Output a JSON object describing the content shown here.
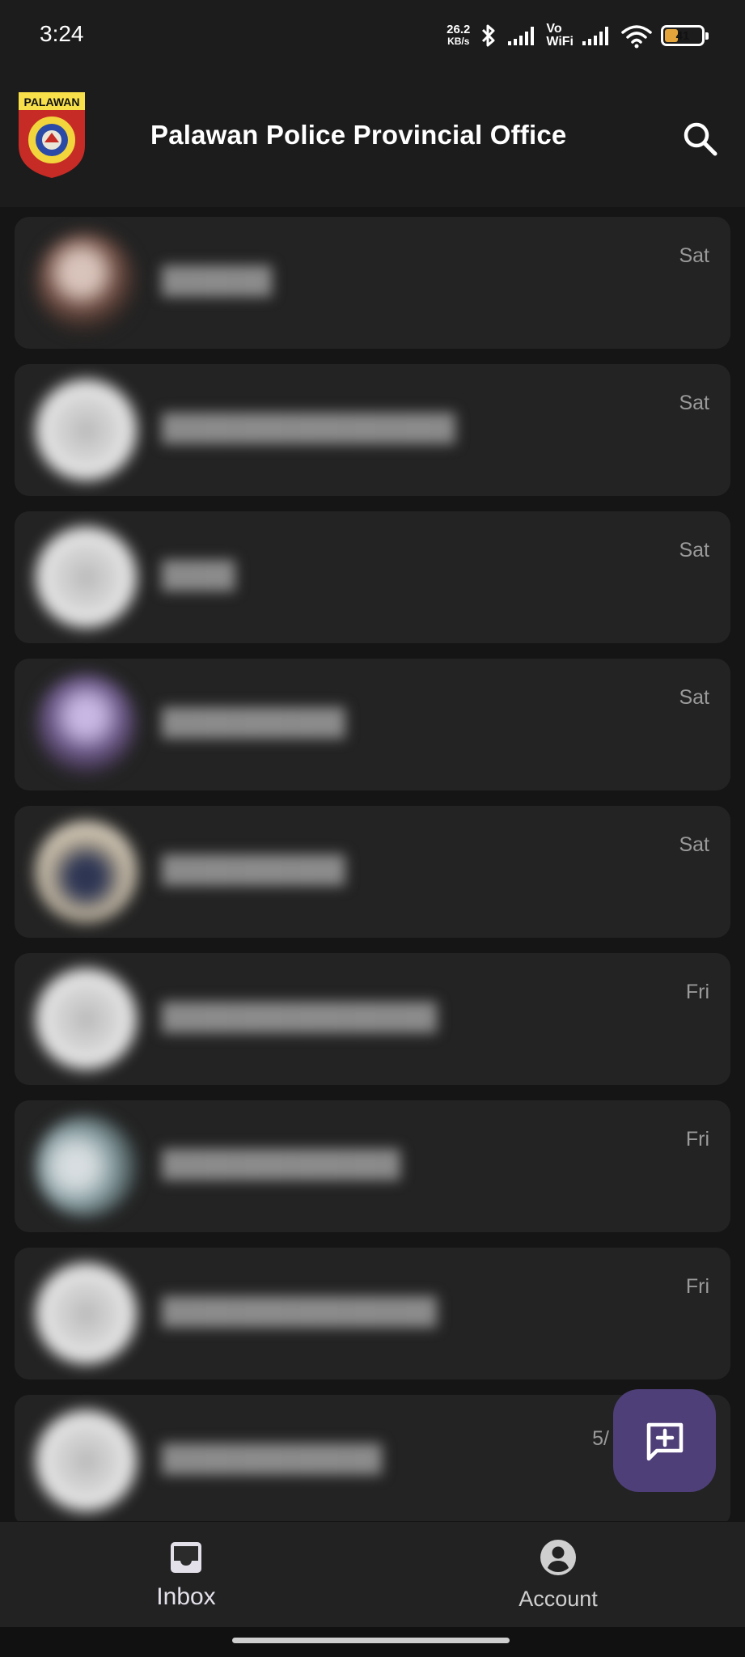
{
  "status_bar": {
    "time": "3:24",
    "net_speed_value": "26.2",
    "net_speed_unit": "KB/s",
    "vowifi_top": "Vo",
    "vowifi_bottom": "WiFi",
    "battery_level": "41",
    "battery_fraction": 0.41,
    "battery_color": "#e2a43b"
  },
  "app_bar": {
    "logo_text": "PALAWAN",
    "title": "Palawan Police Provincial Office",
    "search_icon": "search-icon"
  },
  "chats": [
    {
      "time": "Sat",
      "avatar": "photo-a"
    },
    {
      "time": "Sat",
      "avatar": "default"
    },
    {
      "time": "Sat",
      "avatar": "default"
    },
    {
      "time": "Sat",
      "avatar": "photo-b"
    },
    {
      "time": "Sat",
      "avatar": "photo-c"
    },
    {
      "time": "Fri",
      "avatar": "default"
    },
    {
      "time": "Fri",
      "avatar": "photo-d"
    },
    {
      "time": "Fri",
      "avatar": "default"
    },
    {
      "time": "5/",
      "avatar": "default"
    }
  ],
  "fab": {
    "icon": "add-message-icon",
    "color": "#4f3f78"
  },
  "bottom_nav": {
    "inbox_label": "Inbox",
    "inbox_icon": "inbox-icon",
    "account_label": "Account",
    "account_icon": "account-circle-icon"
  }
}
